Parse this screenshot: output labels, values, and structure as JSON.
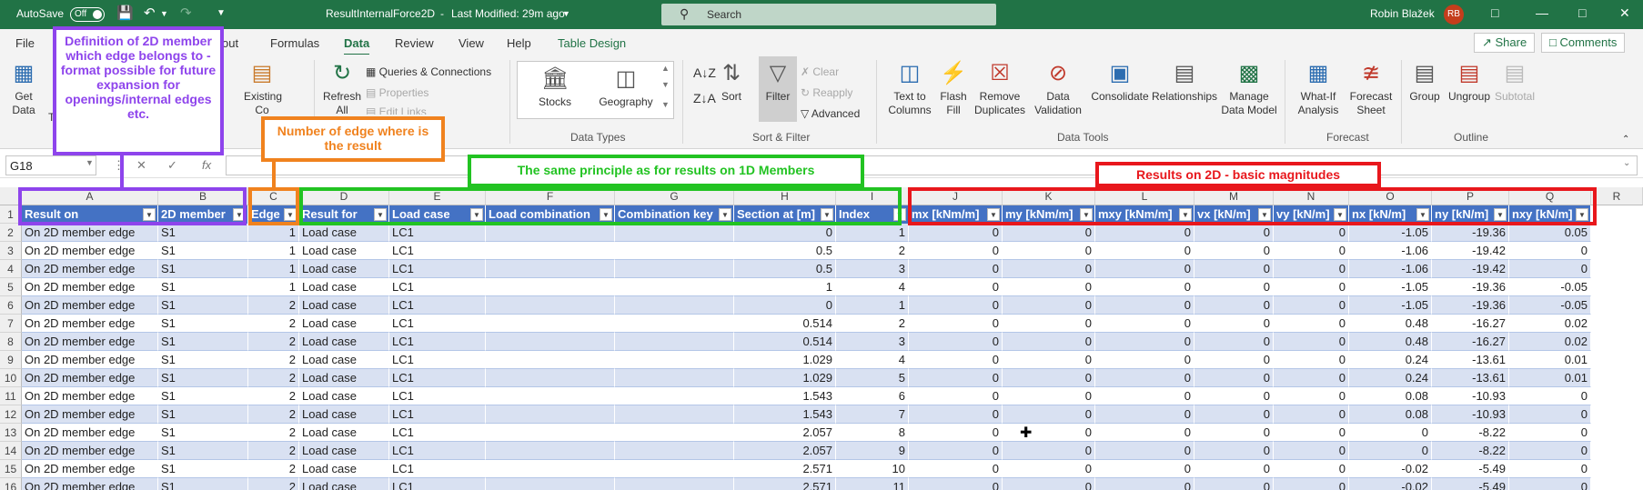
{
  "titlebar": {
    "autosave_label": "AutoSave",
    "autosave_state": "Off",
    "file_name": "ResultInternalForce2D",
    "modified": "Last Modified: 29m ago",
    "search_placeholder": "Search",
    "user_name": "Robin Blažek",
    "user_initials": "RB"
  },
  "menu": {
    "tabs": [
      "File",
      "out",
      "Formulas",
      "Data",
      "Review",
      "View",
      "Help",
      "Table Design"
    ],
    "share_label": "Share",
    "comments_label": "Comments"
  },
  "ribbon": {
    "get_data": "Get Data",
    "get_data_sub": "T",
    "existing": "Existing Co",
    "refresh_all": "Refresh All",
    "queries": "Queries & Connections",
    "properties": "Properties",
    "edit_links": "Edit Links",
    "ns_label": "ns",
    "stocks": "Stocks",
    "geography": "Geography",
    "data_types_group": "Data Types",
    "sort": "Sort",
    "filter": "Filter",
    "clear": "Clear",
    "reapply": "Reapply",
    "advanced": "Advanced",
    "sort_filter_group": "Sort & Filter",
    "text_to_columns": "Text to Columns",
    "flash_fill": "Flash Fill",
    "remove_duplicates": "Remove Duplicates",
    "data_validation": "Data Validation",
    "consolidate": "Consolidate",
    "relationships": "Relationships",
    "manage_model": "Manage Data Model",
    "data_tools_group": "Data Tools",
    "what_if": "What-If Analysis",
    "forecast_sheet": "Forecast Sheet",
    "forecast_group": "Forecast",
    "group": "Group",
    "ungroup": "Ungroup",
    "subtotal": "Subtotal",
    "outline_group": "Outline"
  },
  "formula": {
    "namebox": "G18",
    "fx": "fx",
    "value": ""
  },
  "columns": [
    "A",
    "B",
    "C",
    "D",
    "E",
    "F",
    "G",
    "H",
    "I",
    "J",
    "K",
    "L",
    "M",
    "N",
    "O",
    "P",
    "Q",
    "R"
  ],
  "table_headers": [
    "Result on",
    "2D member",
    "Edge",
    "Result for",
    "Load case",
    "Load combination",
    "Combination key",
    "Section at [m]",
    "Index",
    "mx [kNm/m]",
    "my [kNm/m]",
    "mxy [kNm/m]",
    "vx [kN/m]",
    "vy [kN/m]",
    "nx [kN/m]",
    "ny [kN/m]",
    "nxy [kN/m]"
  ],
  "row_numbers": [
    "1",
    "2",
    "3",
    "4",
    "5",
    "6",
    "7",
    "8",
    "9",
    "10",
    "11",
    "12",
    "13",
    "14",
    "15",
    "16"
  ],
  "rows": [
    [
      "On 2D member edge",
      "S1",
      "1",
      "Load case",
      "LC1",
      "",
      "",
      "0",
      "1",
      "0",
      "0",
      "0",
      "0",
      "0",
      "-1.05",
      "-19.36",
      "0.05"
    ],
    [
      "On 2D member edge",
      "S1",
      "1",
      "Load case",
      "LC1",
      "",
      "",
      "0.5",
      "2",
      "0",
      "0",
      "0",
      "0",
      "0",
      "-1.06",
      "-19.42",
      "0"
    ],
    [
      "On 2D member edge",
      "S1",
      "1",
      "Load case",
      "LC1",
      "",
      "",
      "0.5",
      "3",
      "0",
      "0",
      "0",
      "0",
      "0",
      "-1.06",
      "-19.42",
      "0"
    ],
    [
      "On 2D member edge",
      "S1",
      "1",
      "Load case",
      "LC1",
      "",
      "",
      "1",
      "4",
      "0",
      "0",
      "0",
      "0",
      "0",
      "-1.05",
      "-19.36",
      "-0.05"
    ],
    [
      "On 2D member edge",
      "S1",
      "2",
      "Load case",
      "LC1",
      "",
      "",
      "0",
      "1",
      "0",
      "0",
      "0",
      "0",
      "0",
      "-1.05",
      "-19.36",
      "-0.05"
    ],
    [
      "On 2D member edge",
      "S1",
      "2",
      "Load case",
      "LC1",
      "",
      "",
      "0.514",
      "2",
      "0",
      "0",
      "0",
      "0",
      "0",
      "0.48",
      "-16.27",
      "0.02"
    ],
    [
      "On 2D member edge",
      "S1",
      "2",
      "Load case",
      "LC1",
      "",
      "",
      "0.514",
      "3",
      "0",
      "0",
      "0",
      "0",
      "0",
      "0.48",
      "-16.27",
      "0.02"
    ],
    [
      "On 2D member edge",
      "S1",
      "2",
      "Load case",
      "LC1",
      "",
      "",
      "1.029",
      "4",
      "0",
      "0",
      "0",
      "0",
      "0",
      "0.24",
      "-13.61",
      "0.01"
    ],
    [
      "On 2D member edge",
      "S1",
      "2",
      "Load case",
      "LC1",
      "",
      "",
      "1.029",
      "5",
      "0",
      "0",
      "0",
      "0",
      "0",
      "0.24",
      "-13.61",
      "0.01"
    ],
    [
      "On 2D member edge",
      "S1",
      "2",
      "Load case",
      "LC1",
      "",
      "",
      "1.543",
      "6",
      "0",
      "0",
      "0",
      "0",
      "0",
      "0.08",
      "-10.93",
      "0"
    ],
    [
      "On 2D member edge",
      "S1",
      "2",
      "Load case",
      "LC1",
      "",
      "",
      "1.543",
      "7",
      "0",
      "0",
      "0",
      "0",
      "0",
      "0.08",
      "-10.93",
      "0"
    ],
    [
      "On 2D member edge",
      "S1",
      "2",
      "Load case",
      "LC1",
      "",
      "",
      "2.057",
      "8",
      "0",
      "0",
      "0",
      "0",
      "0",
      "0",
      "-8.22",
      "0"
    ],
    [
      "On 2D member edge",
      "S1",
      "2",
      "Load case",
      "LC1",
      "",
      "",
      "2.057",
      "9",
      "0",
      "0",
      "0",
      "0",
      "0",
      "0",
      "-8.22",
      "0"
    ],
    [
      "On 2D member edge",
      "S1",
      "2",
      "Load case",
      "LC1",
      "",
      "",
      "2.571",
      "10",
      "0",
      "0",
      "0",
      "0",
      "0",
      "-0.02",
      "-5.49",
      "0"
    ],
    [
      "On 2D member edge",
      "S1",
      "2",
      "Load case",
      "LC1",
      "",
      "",
      "2.571",
      "11",
      "0",
      "0",
      "0",
      "0",
      "0",
      "-0.02",
      "-5.49",
      "0"
    ]
  ],
  "annotations": {
    "member_def": "Definition of 2D member which edge belongs to - format possible for future expansion for openings/internal edges etc.",
    "edge_number": "Number of edge where is the result",
    "same_principle": "The same principle as for results on 1D Members",
    "results_2d": "Results on 2D - basic magnitudes"
  },
  "colors": {
    "excel_green": "#217346",
    "purple": "#8e44ec",
    "orange": "#f0821e",
    "green": "#22c322",
    "red": "#e8171c",
    "table_header": "#4472c4",
    "band": "#d9e1f2"
  }
}
